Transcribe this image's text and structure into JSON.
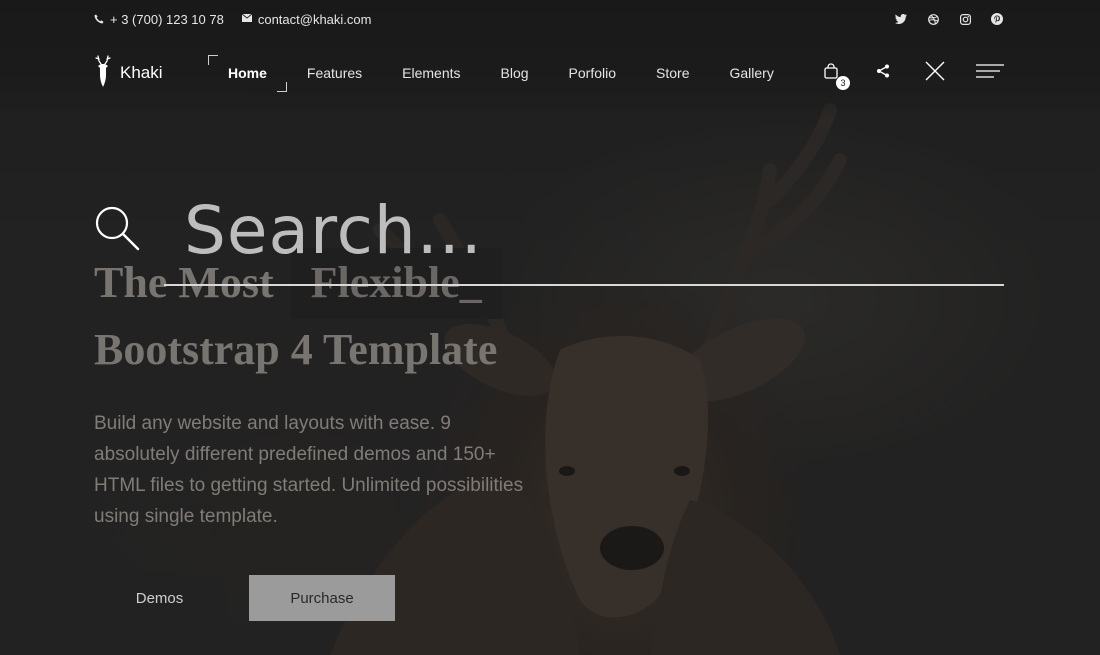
{
  "topbar": {
    "phone": "+ 3 (700) 123 10 78",
    "email": "contact@khaki.com",
    "social": [
      "twitter-icon",
      "dribbble-icon",
      "instagram-icon",
      "pinterest-icon"
    ]
  },
  "brand": {
    "name": "Khaki",
    "logo": "deer-icon"
  },
  "nav": {
    "items": [
      {
        "label": "Home",
        "active": true
      },
      {
        "label": "Features"
      },
      {
        "label": "Elements"
      },
      {
        "label": "Blog"
      },
      {
        "label": "Porfolio"
      },
      {
        "label": "Store"
      },
      {
        "label": "Gallery"
      }
    ],
    "cart_count": "3"
  },
  "search": {
    "placeholder": "Search..."
  },
  "hero": {
    "title_part1": "The Most",
    "title_highlight": "Flexible_",
    "title_line2": "Bootstrap 4 Template",
    "description": "Build any website and layouts with ease. 9 absolutely different predefined demos and 150+ HTML files to getting started. Unlimited possibilities using single template.",
    "btn_demos": "Demos",
    "btn_purchase": "Purchase"
  },
  "colors": {
    "overlay": "#1e1e1e",
    "button_dark": "#222222",
    "button_light": "#9b9b9b",
    "text_muted": "#807c78"
  }
}
